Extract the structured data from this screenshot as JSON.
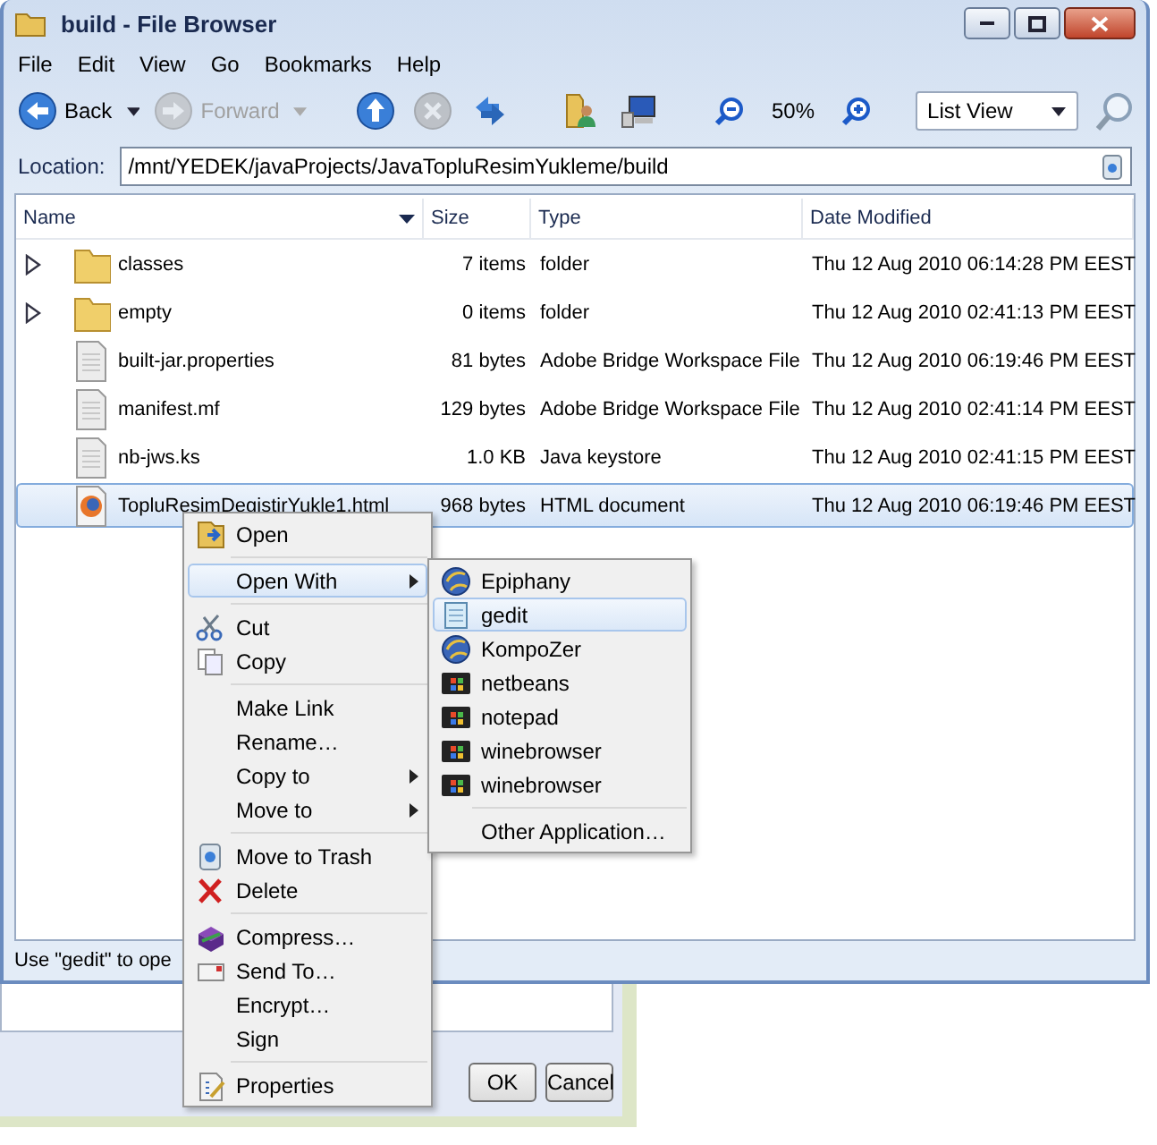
{
  "window": {
    "title": "build - File Browser"
  },
  "menu_bar": [
    "File",
    "Edit",
    "View",
    "Go",
    "Bookmarks",
    "Help"
  ],
  "toolbar": [
    {
      "kind": "back",
      "label": "Back",
      "disabled": false
    },
    {
      "kind": "forward",
      "label": "Forward",
      "disabled": true
    },
    {
      "kind": "up",
      "disabled": false
    },
    {
      "kind": "stop",
      "disabled": true
    },
    {
      "kind": "reload",
      "disabled": false
    },
    {
      "kind": "home",
      "disabled": false
    },
    {
      "kind": "computer",
      "disabled": false
    },
    {
      "kind": "zoom_out",
      "disabled": false
    },
    {
      "kind": "zoom_level",
      "label": "50%"
    },
    {
      "kind": "zoom_in",
      "disabled": false
    },
    {
      "kind": "view_select",
      "label": "List View"
    },
    {
      "kind": "search",
      "disabled": false
    }
  ],
  "location": {
    "label": "Location:",
    "value": "/mnt/YEDEK/javaProjects/JavaTopluResimYukleme/build"
  },
  "table": {
    "columns": [
      {
        "label": "Name",
        "sorted": true
      },
      {
        "label": "Size",
        "sorted": false
      },
      {
        "label": "Type",
        "sorted": false
      },
      {
        "label": "Date Modified",
        "sorted": false
      }
    ],
    "rows": [
      {
        "kind": "folder",
        "name": "classes",
        "size": "7 items",
        "type": "folder",
        "date": "Thu 12 Aug 2010 06:14:28 PM EEST",
        "selected": false
      },
      {
        "kind": "folder",
        "name": "empty",
        "size": "0 items",
        "type": "folder",
        "date": "Thu 12 Aug 2010 02:41:13 PM EEST",
        "selected": false
      },
      {
        "kind": "file",
        "name": "built-jar.properties",
        "size": "81 bytes",
        "type": "Adobe Bridge Workspace File",
        "date": "Thu 12 Aug 2010 06:19:46 PM EEST",
        "selected": false
      },
      {
        "kind": "file",
        "name": "manifest.mf",
        "size": "129 bytes",
        "type": "Adobe Bridge Workspace File",
        "date": "Thu 12 Aug 2010 02:41:14 PM EEST",
        "selected": false
      },
      {
        "kind": "file",
        "name": "nb-jws.ks",
        "size": "1.0 KB",
        "type": "Java keystore",
        "date": "Thu 12 Aug 2010 02:41:15 PM EEST",
        "selected": false
      },
      {
        "kind": "html",
        "name": "TopluResimDegistirYukle1.html",
        "size": "968 bytes",
        "type": "HTML document",
        "date": "Thu 12 Aug 2010 06:19:46 PM EEST",
        "selected": true
      }
    ]
  },
  "context_menu": [
    {
      "kind": "item",
      "label": "Open",
      "submenu": false,
      "selected": false
    },
    {
      "kind": "separator"
    },
    {
      "kind": "item",
      "label": "Open With",
      "submenu": true,
      "selected": true
    },
    {
      "kind": "separator"
    },
    {
      "kind": "item",
      "label": "Cut",
      "submenu": false,
      "selected": false
    },
    {
      "kind": "item",
      "label": "Copy",
      "submenu": false,
      "selected": false
    },
    {
      "kind": "separator"
    },
    {
      "kind": "item",
      "label": "Make Link",
      "submenu": false,
      "selected": false
    },
    {
      "kind": "item",
      "label": "Rename…",
      "submenu": false,
      "selected": false
    },
    {
      "kind": "item",
      "label": "Copy to",
      "submenu": true,
      "selected": false
    },
    {
      "kind": "item",
      "label": "Move to",
      "submenu": true,
      "selected": false
    },
    {
      "kind": "separator"
    },
    {
      "kind": "item",
      "label": "Move to Trash",
      "submenu": false,
      "selected": false
    },
    {
      "kind": "item",
      "label": "Delete",
      "submenu": false,
      "selected": false
    },
    {
      "kind": "separator"
    },
    {
      "kind": "item",
      "label": "Compress…",
      "submenu": false,
      "selected": false
    },
    {
      "kind": "item",
      "label": "Send To…",
      "submenu": false,
      "selected": false
    },
    {
      "kind": "item",
      "label": "Encrypt…",
      "submenu": false,
      "selected": false
    },
    {
      "kind": "item",
      "label": "Sign",
      "submenu": false,
      "selected": false
    },
    {
      "kind": "separator"
    },
    {
      "kind": "item",
      "label": "Properties",
      "submenu": false,
      "selected": false
    }
  ],
  "open_with_menu": [
    {
      "kind": "item",
      "label": "Epiphany",
      "selected": false
    },
    {
      "kind": "item",
      "label": "gedit",
      "selected": true
    },
    {
      "kind": "item",
      "label": "KompoZer",
      "selected": false
    },
    {
      "kind": "item",
      "label": "netbeans",
      "selected": false
    },
    {
      "kind": "item",
      "label": "notepad",
      "selected": false
    },
    {
      "kind": "item",
      "label": "winebrowser",
      "selected": false
    },
    {
      "kind": "item",
      "label": "winebrowser",
      "selected": false
    },
    {
      "kind": "separator"
    },
    {
      "kind": "item",
      "label": "Other Application…",
      "selected": false
    }
  ],
  "status_bar": "Use \"gedit\" to ope",
  "dialog_behind": {
    "buttons": [
      "OK",
      "Cancel"
    ]
  }
}
